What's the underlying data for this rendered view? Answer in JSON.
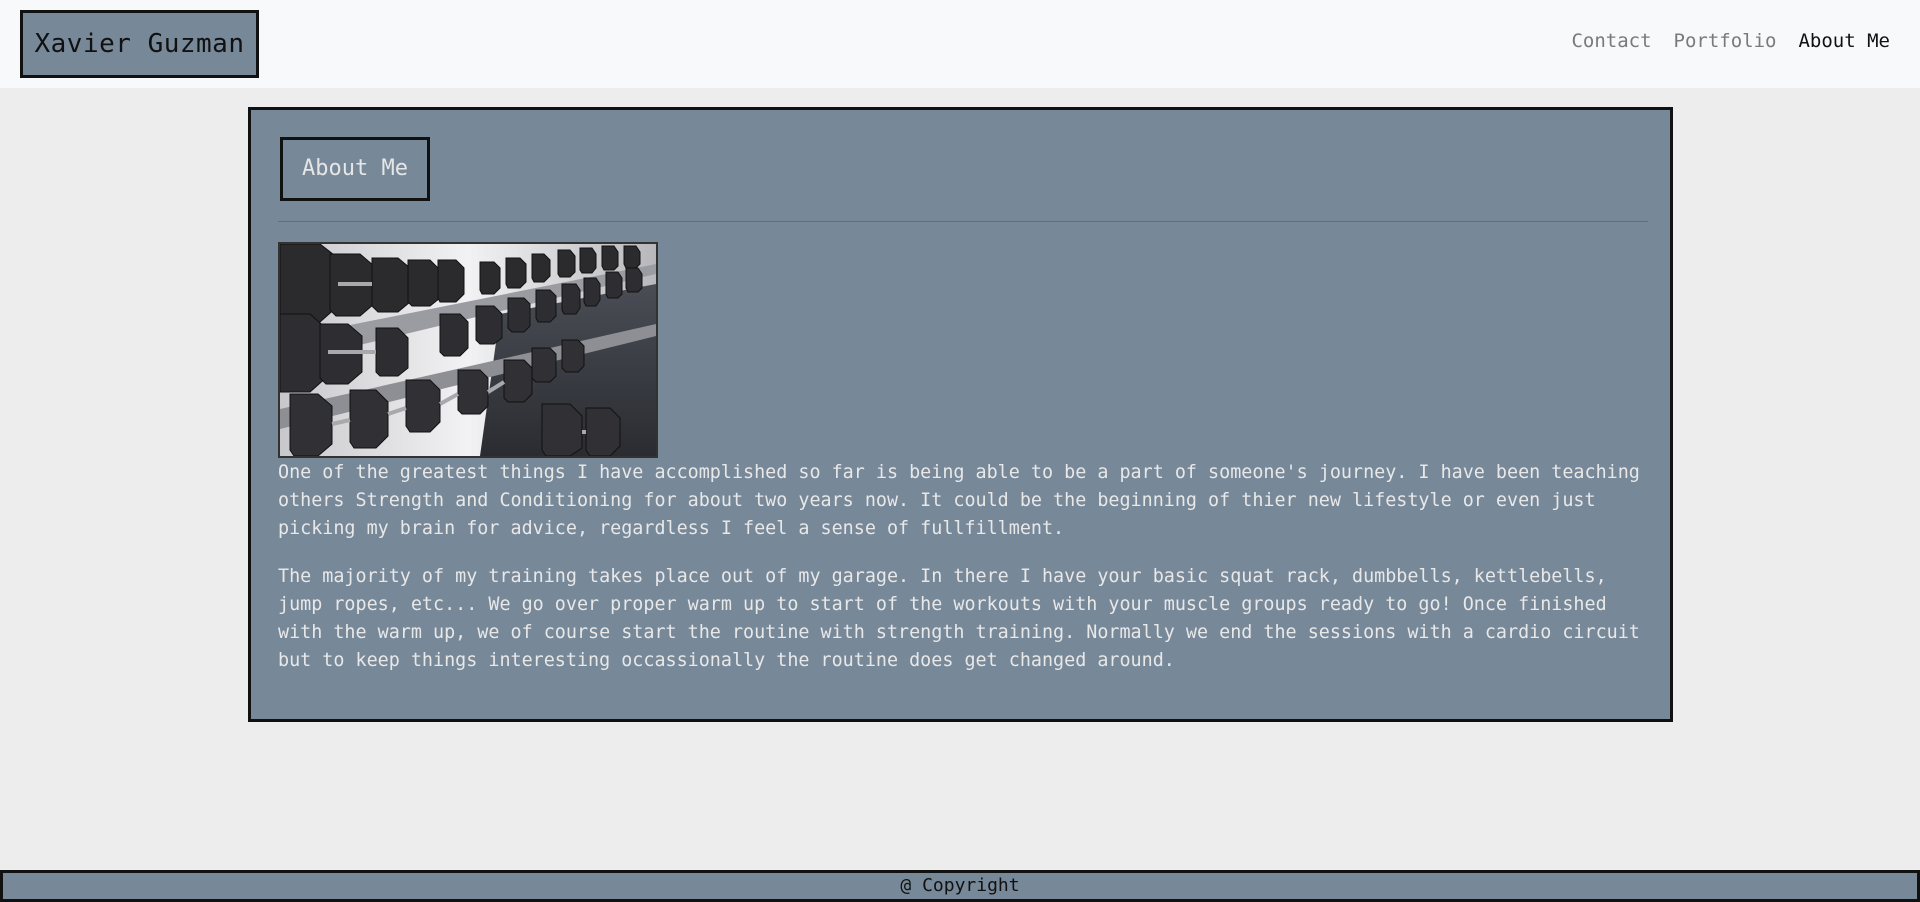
{
  "header": {
    "brand": "Xavier Guzman",
    "nav": [
      {
        "label": "Contact",
        "active": false
      },
      {
        "label": "Portfolio",
        "active": false
      },
      {
        "label": "About Me",
        "active": true
      }
    ]
  },
  "main": {
    "title": "About Me",
    "image": {
      "icon": "dumbbell-rack-photo"
    },
    "paragraphs": [
      "One of the greatest things I have accomplished so far is being able to be a part of someone's journey. I have been teaching others Strength and Conditioning for about two years now. It could be the beginning of thier new lifestyle or even just picking my brain for advice, regardless I feel a sense of fullfillment.",
      "The majority of my training takes place out of my garage. In there I have your basic squat rack, dumbbells, kettlebells, jump ropes, etc... We go over proper warm up to start of the workouts with your muscle groups ready to go! Once finished with the warm up, we of course start the routine with strength training. Normally we end the sessions with a cardio circuit but to keep things interesting occassionally the routine does get changed around."
    ]
  },
  "footer": {
    "text": "@ Copyright"
  },
  "colors": {
    "navbar_bg": "#f8f9fa",
    "page_bg": "#ededed",
    "card_bg": "#778899",
    "border": "#111111",
    "text_light": "#e8e8e8"
  }
}
